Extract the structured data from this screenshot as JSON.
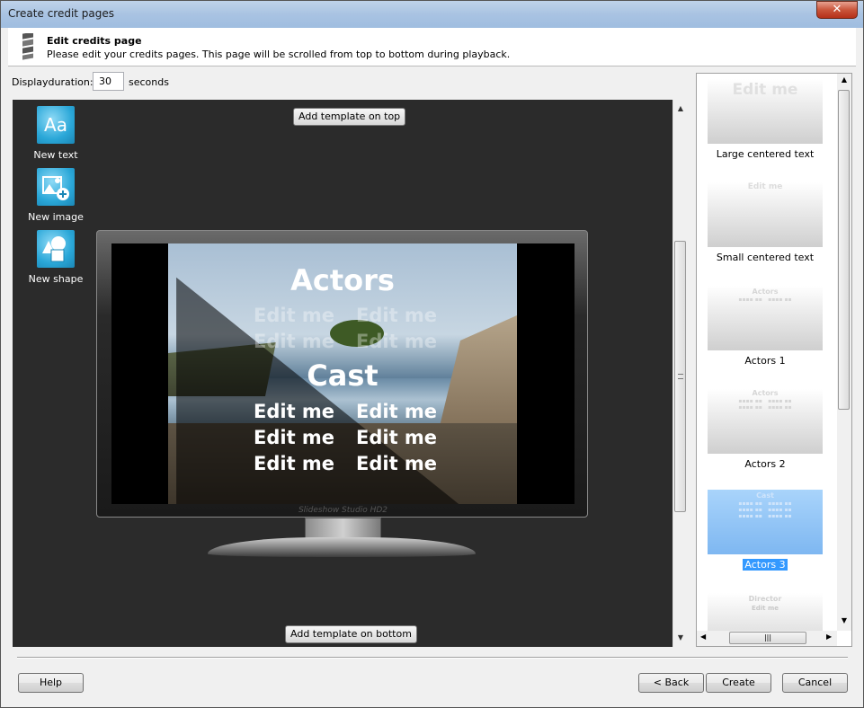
{
  "window": {
    "title": "Create credit pages",
    "close_label": "✕"
  },
  "header": {
    "title": "Edit credits page",
    "subtitle": "Please edit your credits pages. This page will be scrolled from top to bottom during playback."
  },
  "duration": {
    "label": "Displayduration:",
    "value": "30",
    "unit": "seconds"
  },
  "tools": [
    {
      "label": "New text",
      "glyph": "Aa"
    },
    {
      "label": "New image",
      "glyph": ""
    },
    {
      "label": "New shape",
      "glyph": ""
    }
  ],
  "canvas": {
    "add_top_label": "Add template on top",
    "add_bottom_label": "Add template on bottom",
    "preview": {
      "heading_1": "Actors",
      "heading_2": "Cast",
      "edit_me": "Edit me",
      "brand": "Slideshow Studio HD2"
    }
  },
  "templates": [
    {
      "caption": "Large centered text",
      "preview_text": "Edit me",
      "selected": false
    },
    {
      "caption": "Small centered text",
      "preview_text": "Edit me",
      "selected": false
    },
    {
      "caption": "Actors 1",
      "preview_text": "Actors",
      "selected": false
    },
    {
      "caption": "Actors 2",
      "preview_text": "Actors",
      "selected": false
    },
    {
      "caption": "Actors 3",
      "preview_text": "Cast",
      "selected": true
    },
    {
      "caption": "",
      "preview_text": "Director",
      "selected": false
    }
  ],
  "footer": {
    "help_label": "Help",
    "back_label": "< Back",
    "create_label": "Create",
    "cancel_label": "Cancel"
  }
}
